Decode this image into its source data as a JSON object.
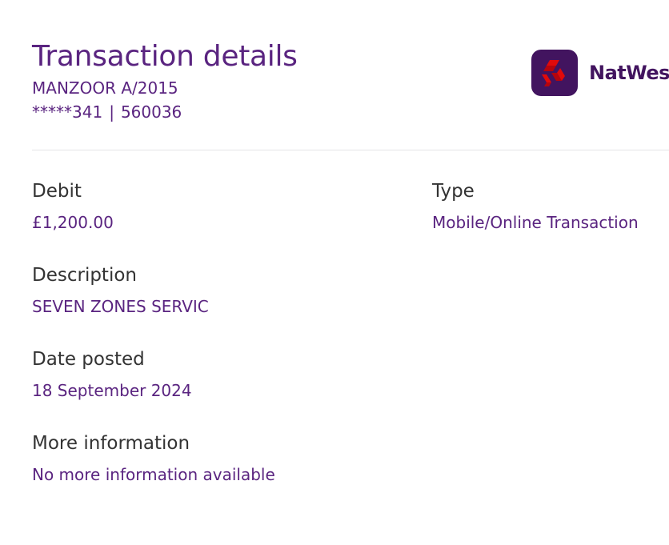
{
  "header": {
    "title": "Transaction details",
    "account_name": "MANZOOR A/2015",
    "account_number": "*****341",
    "separator": "|",
    "sort_code": "560036"
  },
  "brand": {
    "name": "NatWest",
    "logo_icon": "natwest-cubes-icon",
    "logo_tile_color": "#42145f",
    "logo_mark_color": "#e10a0a"
  },
  "colors": {
    "accent": "#5a2480",
    "label": "#333333"
  },
  "fields": {
    "debit": {
      "label": "Debit",
      "value": "£1,200.00"
    },
    "type": {
      "label": "Type",
      "value": "Mobile/Online Transaction"
    },
    "description": {
      "label": "Description",
      "value": "SEVEN ZONES SERVIC"
    },
    "date_posted": {
      "label": "Date posted",
      "value": "18 September 2024"
    },
    "more_information": {
      "label": "More information",
      "value": "No more information available"
    }
  }
}
